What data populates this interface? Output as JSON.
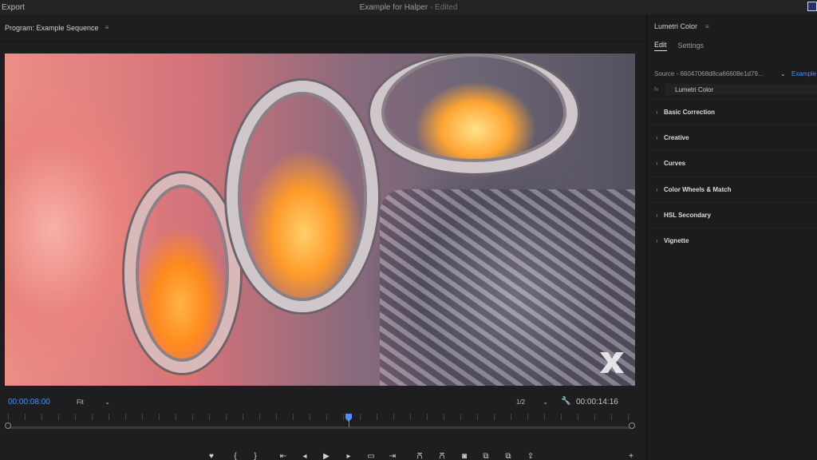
{
  "topbar": {
    "export_label": "Export",
    "title": "Example for Halper",
    "title_status": "- Edited"
  },
  "program": {
    "title": "Program: Example Sequence",
    "menu_icon": "hamburger-icon",
    "timecode_current": "00:00:08:00",
    "fit_value": "Fit",
    "resolution_value": "1/2",
    "timecode_duration": "00:00:14:16",
    "transport_icons": [
      "marker-icon",
      "mark-in-icon",
      "mark-out-icon",
      "go-to-in-icon",
      "step-back-icon",
      "play-icon",
      "step-forward-icon",
      "safe-margins-icon",
      "go-to-out-icon",
      "lift-icon",
      "extract-icon",
      "export-frame-icon",
      "insert-icon",
      "overwrite-icon",
      "share-icon",
      "add-button-icon"
    ]
  },
  "lumetri": {
    "title": "Lumetri Color",
    "tabs": [
      {
        "label": "Edit",
        "active": true
      },
      {
        "label": "Settings",
        "active": false
      }
    ],
    "source_label": "Source - 66047068d8ca66608e1d79...",
    "source_link": "Example",
    "effect_name": "Lumetri Color",
    "sections": [
      "Basic Correction",
      "Creative",
      "Curves",
      "Color Wheels & Match",
      "HSL Secondary",
      "Vignette"
    ]
  },
  "colors": {
    "accent": "#4d8ff5",
    "panel_bg": "#1c1c1e",
    "text": "#c8c8c8"
  }
}
